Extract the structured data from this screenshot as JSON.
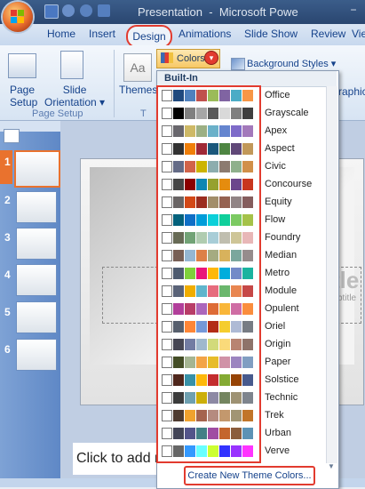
{
  "window": {
    "title": "Presentation",
    "app_name": "Microsoft Powe",
    "title_separator": "-",
    "minimize_glyph": "−"
  },
  "tabs": [
    "Home",
    "Insert",
    "Design",
    "Animations",
    "Slide Show",
    "Review",
    "Vie"
  ],
  "ribbon": {
    "page_setup_label_1": "Page",
    "page_setup_label_2": "Setup",
    "slide_orientation_label_1": "Slide",
    "slide_orientation_label_2": "Orientation",
    "page_setup_group": "Page Setup",
    "themes_label": "Themes",
    "themes_group_partial": "T",
    "colors_label": "Colors",
    "background_styles_label": "Background Styles",
    "graphics_partial": "raphic",
    "dropdown_arrow": "▾"
  },
  "slides": {
    "numbers": [
      "1",
      "2",
      "3",
      "4",
      "5",
      "6"
    ],
    "click_to_add": "Click to add n",
    "title_partial": "tle",
    "subtitle_partial": "btitle"
  },
  "colors_dropdown": {
    "header": "Built-In",
    "themes": [
      "Office",
      "Grayscale",
      "Apex",
      "Aspect",
      "Civic",
      "Concourse",
      "Equity",
      "Flow",
      "Foundry",
      "Median",
      "Metro",
      "Module",
      "Opulent",
      "Oriel",
      "Origin",
      "Paper",
      "Solstice",
      "Technic",
      "Trek",
      "Urban",
      "Verve"
    ],
    "create_button": "Create New Theme Colors...",
    "scroll_down_glyph": "▼"
  },
  "colors": {
    "accent_highlight": "#e23b2f",
    "ribbon_text": "#15428b"
  }
}
